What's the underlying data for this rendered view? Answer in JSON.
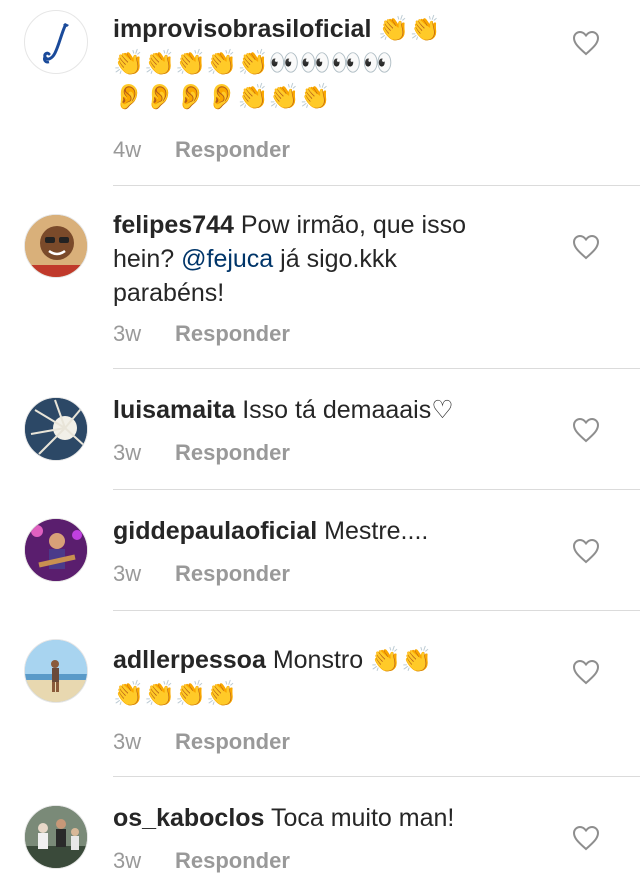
{
  "comments": [
    {
      "username": "improvisobrasiloficial",
      "text": "",
      "emoji_line1": "👏👏",
      "emoji_line2": "👏👏👏👏👏👀👀👀👀",
      "emoji_line3": "👂👂👂👂👏👏👏",
      "time": "4w",
      "reply": "Responder",
      "avatar_icon": "saxophone-logo-icon"
    },
    {
      "username": "felipes744",
      "text_before": "Pow irmão, que isso hein?",
      "mention": "@fejuca",
      "text_after": "já sigo.kkk parabéns!",
      "time": "3w",
      "reply": "Responder",
      "avatar_icon": "person-avatar"
    },
    {
      "username": "luisamaita",
      "text": "Isso tá demaaais♡",
      "time": "3w",
      "reply": "Responder",
      "avatar_icon": "sunburst-avatar"
    },
    {
      "username": "giddepaulaoficial",
      "text": "Mestre....",
      "time": "3w",
      "reply": "Responder",
      "avatar_icon": "guitarist-avatar"
    },
    {
      "username": "adllerpessoa",
      "text": "Monstro",
      "emoji_line1": "👏👏",
      "emoji_line2": "👏👏👏👏",
      "time": "3w",
      "reply": "Responder",
      "avatar_icon": "beach-avatar"
    },
    {
      "username": "os_kaboclos",
      "text": "Toca muito man!",
      "time": "3w",
      "reply": "Responder",
      "avatar_icon": "group-avatar"
    }
  ],
  "colors": {
    "username": "#262626",
    "meta": "#999999",
    "mention": "#003569",
    "divider": "#dbdbdb"
  },
  "like_icon": "heart-outline-icon"
}
